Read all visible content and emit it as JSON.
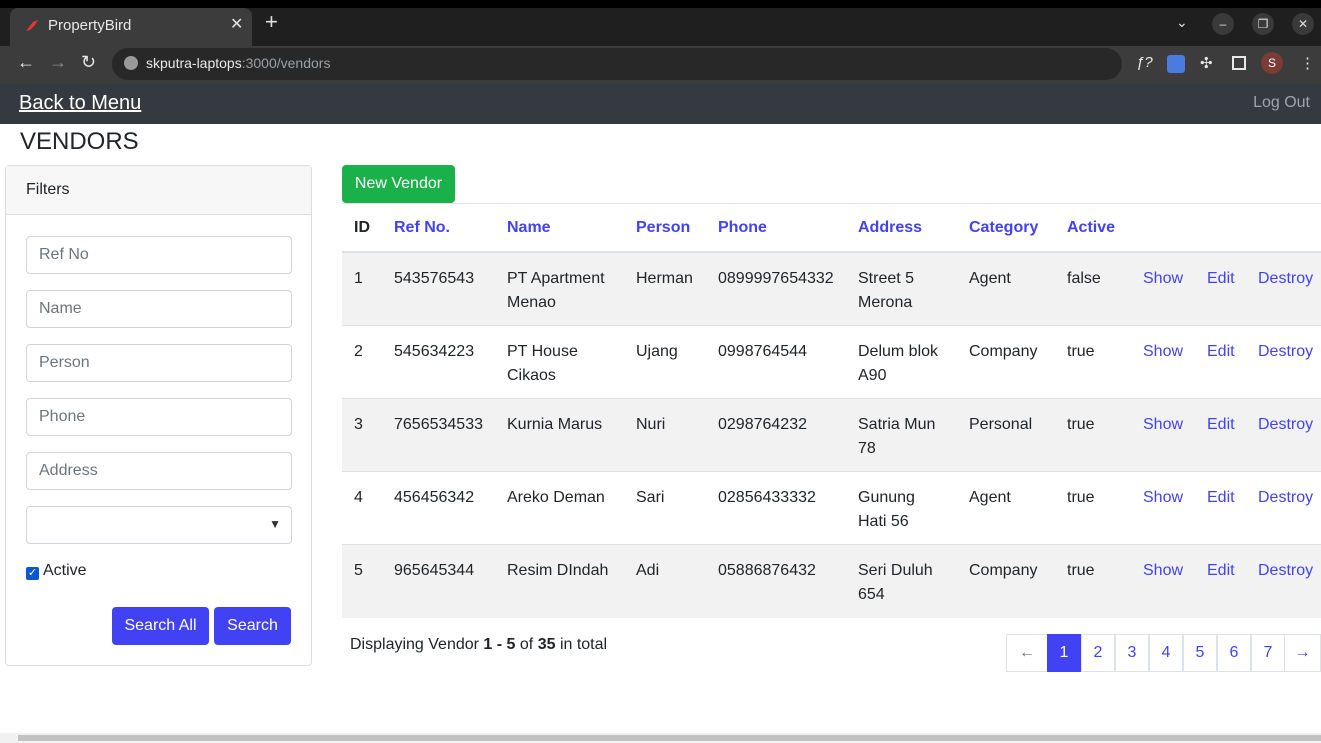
{
  "browser": {
    "tab_title": "PropertyBird",
    "url_host": "skputra-laptops",
    "url_rest": ":3000/vendors",
    "profile_initial": "S"
  },
  "navbar": {
    "back_label": "Back to Menu",
    "logout_label": "Log Out"
  },
  "page": {
    "title": "VENDORS"
  },
  "filters": {
    "header": "Filters",
    "ref_no_placeholder": "Ref No",
    "name_placeholder": "Name",
    "person_placeholder": "Person",
    "phone_placeholder": "Phone",
    "address_placeholder": "Address",
    "category_value": "",
    "active_label": "Active",
    "active_checked": true,
    "search_all_label": "Search All",
    "search_label": "Search"
  },
  "main": {
    "new_vendor_label": "New Vendor",
    "columns": [
      "ID",
      "Ref No.",
      "Name",
      "Person",
      "Phone",
      "Address",
      "Category",
      "Active"
    ],
    "actions": {
      "show": "Show",
      "edit": "Edit",
      "destroy": "Destroy"
    },
    "rows": [
      {
        "id": "1",
        "ref": "543576543",
        "name": [
          "PT Apartment",
          "Menao"
        ],
        "person": "Herman",
        "phone": "0899997654332",
        "address": [
          "Street 5",
          "Merona"
        ],
        "category": "Agent",
        "active": "false"
      },
      {
        "id": "2",
        "ref": "545634223",
        "name": [
          "PT House",
          "Cikaos"
        ],
        "person": "Ujang",
        "phone": "0998764544",
        "address": [
          "Delum blok",
          "A90"
        ],
        "category": "Company",
        "active": "true"
      },
      {
        "id": "3",
        "ref": "7656534533",
        "name": [
          "Kurnia Marus",
          ""
        ],
        "person": "Nuri",
        "phone": "0298764232",
        "address": [
          "Satria Mun",
          "78"
        ],
        "category": "Personal",
        "active": "true"
      },
      {
        "id": "4",
        "ref": "456456342",
        "name": [
          "Areko Deman",
          ""
        ],
        "person": "Sari",
        "phone": "02856433332",
        "address": [
          "Gunung",
          "Hati 56"
        ],
        "category": "Agent",
        "active": "true"
      },
      {
        "id": "5",
        "ref": "965645344",
        "name": [
          "Resim DIndah",
          ""
        ],
        "person": "Adi",
        "phone": "05886876432",
        "address": [
          "Seri Duluh",
          "654"
        ],
        "category": "Company",
        "active": "true"
      }
    ],
    "display": {
      "prefix": "Displaying Vendor",
      "range": "1 - 5",
      "of": "of",
      "total": "35",
      "suffix": "in total"
    },
    "pagination": {
      "prev": "←",
      "pages": [
        "1",
        "2",
        "3",
        "4",
        "5",
        "6",
        "7"
      ],
      "current": "1",
      "next": "→"
    }
  }
}
